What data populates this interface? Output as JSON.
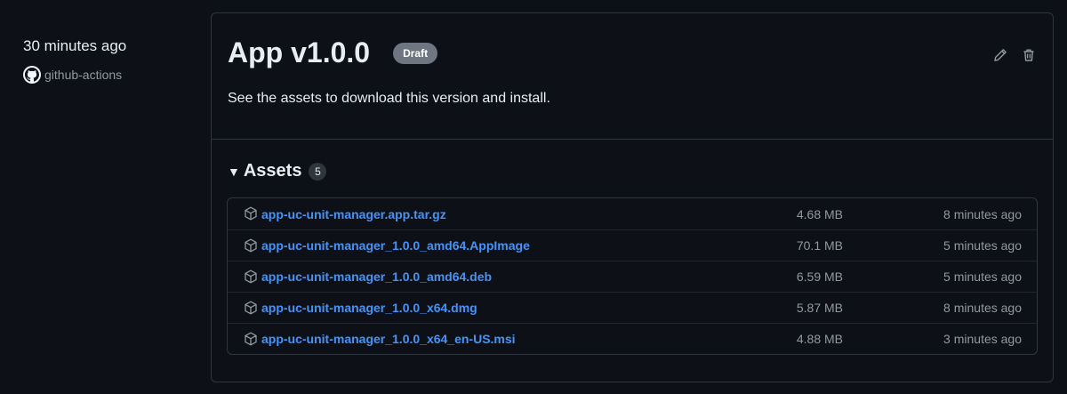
{
  "sidebar": {
    "time": "30 minutes ago",
    "author": "github-actions"
  },
  "release": {
    "title": "App v1.0.0",
    "badge": "Draft",
    "description": "See the assets to download this version and install."
  },
  "assets": {
    "heading": "Assets",
    "count": "5",
    "items": [
      {
        "name": "app-uc-unit-manager.app.tar.gz",
        "size": "4.68 MB",
        "age": "8 minutes ago"
      },
      {
        "name": "app-uc-unit-manager_1.0.0_amd64.AppImage",
        "size": "70.1 MB",
        "age": "5 minutes ago"
      },
      {
        "name": "app-uc-unit-manager_1.0.0_amd64.deb",
        "size": "6.59 MB",
        "age": "5 minutes ago"
      },
      {
        "name": "app-uc-unit-manager_1.0.0_x64.dmg",
        "size": "5.87 MB",
        "age": "8 minutes ago"
      },
      {
        "name": "app-uc-unit-manager_1.0.0_x64_en-US.msi",
        "size": "4.88 MB",
        "age": "3 minutes ago"
      }
    ]
  },
  "colors": {
    "link": "#4493f8",
    "muted": "#9198a1",
    "background": "#0d1117",
    "border": "#30363d"
  },
  "icons": [
    "github-icon",
    "pencil-icon",
    "trash-icon",
    "package-icon",
    "caret-down-icon"
  ]
}
